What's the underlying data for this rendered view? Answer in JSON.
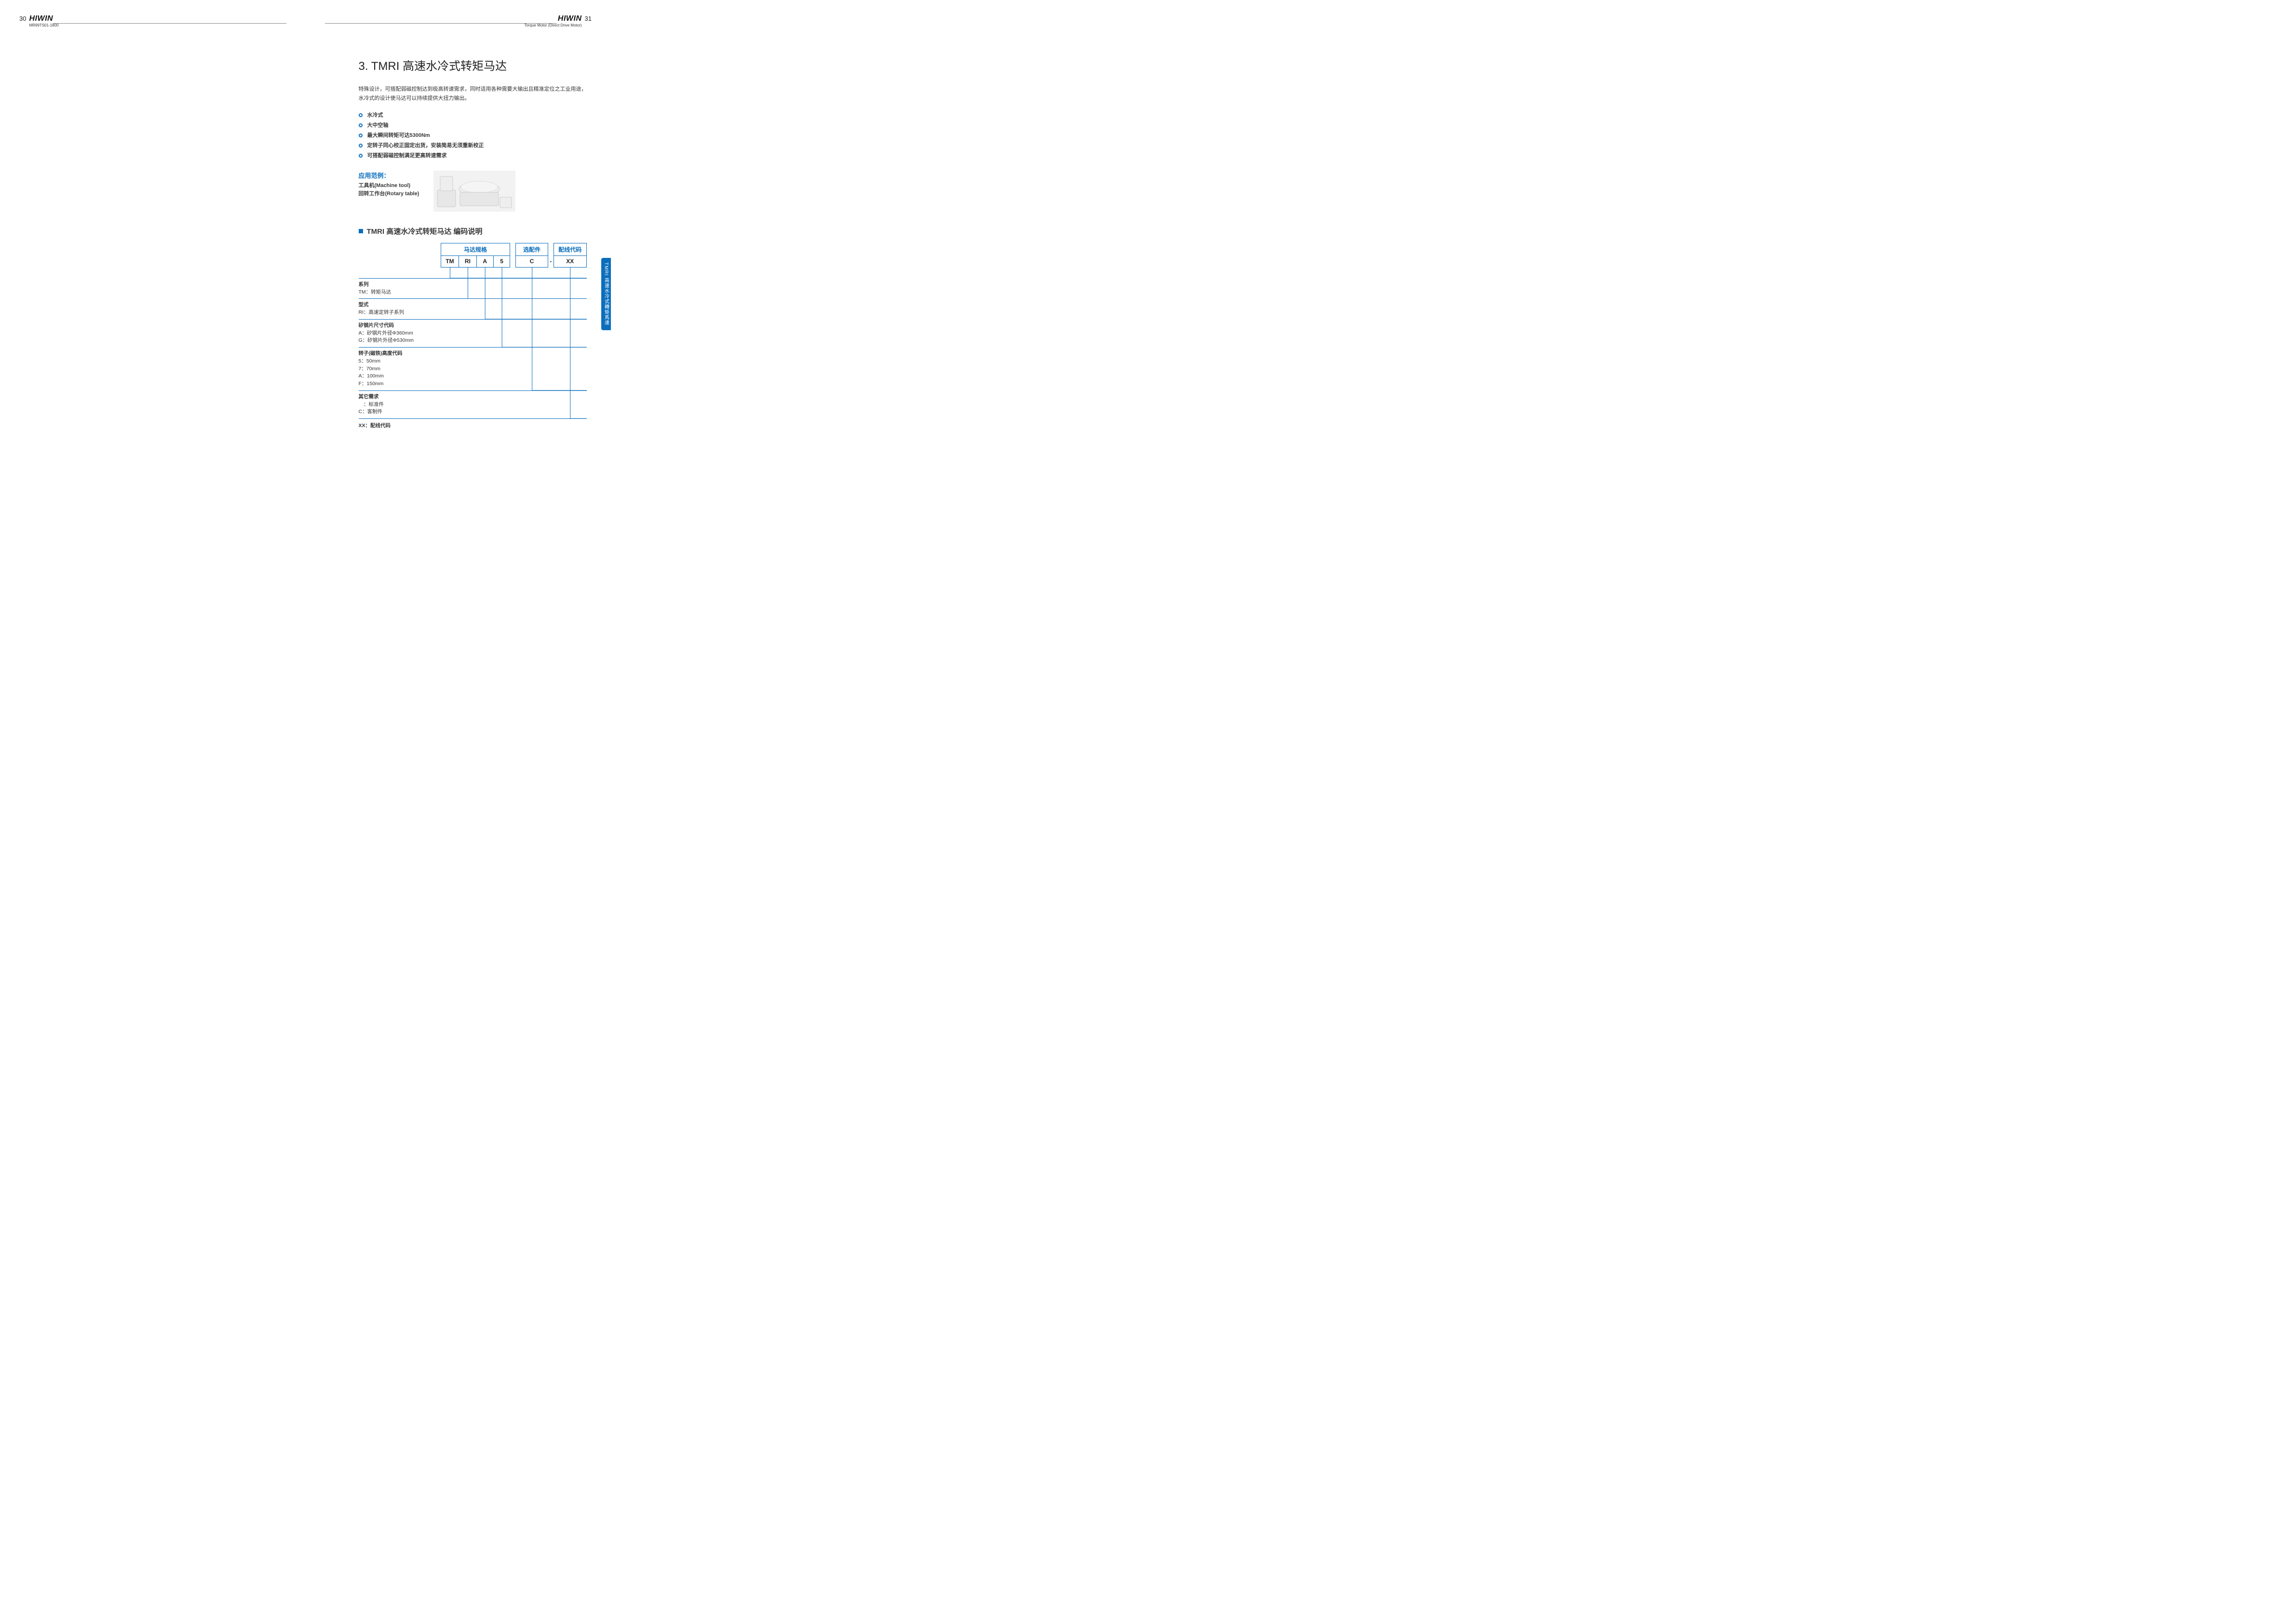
{
  "pageLeft": {
    "num": "30",
    "brand": "HIWIN",
    "sub": "MR99TS01-1800"
  },
  "pageRight": {
    "num": "31",
    "brand": "HIWIN",
    "sub": "Torque Motor (Direct Drive Motor)"
  },
  "title": "3. TMRI 高速水冷式转矩马达",
  "intro": "特殊设计，可搭配弱磁控制达到极高转速需求，同时适用各种需要大输出且精准定位之工业用途，水冷式的设计使马达可以持续提供大扭力输出。",
  "bullets": [
    "水冷式",
    "大中空轴",
    "最大瞬间转矩可达5300Nm",
    "定转子同心校正固定出货，安装简易无须重新校正",
    "可搭配弱磁控制满足更高转速需求"
  ],
  "applications": {
    "heading": "应用范例：",
    "items": [
      "工具机(Machine tool)",
      "回转工作台(Rotary table)"
    ]
  },
  "subheading": "TMRI 高速水冷式转矩马达 编码说明",
  "codeTable": {
    "headers": {
      "spec": "马达规格",
      "option": "选配件",
      "wire": "配线代码"
    },
    "row": {
      "tm": "TM",
      "ri": "RI",
      "a": "A",
      "five": "5",
      "c": "C",
      "dash": "-",
      "xx": "XX"
    }
  },
  "explains": [
    {
      "title": "系列",
      "lines": [
        "TM：转矩马达"
      ]
    },
    {
      "title": "型式",
      "lines": [
        "RI：高速定转子系列"
      ]
    },
    {
      "title": "矽钢片尺寸代码",
      "lines": [
        "A：矽钢片外径Φ360mm",
        "G：矽钢片外径Φ530mm"
      ]
    },
    {
      "title": "转子(磁铁)高度代码",
      "lines": [
        "5：50mm",
        "7：70mm",
        "A：100mm",
        "F：150mm"
      ]
    },
    {
      "title": "其它需求",
      "lines": [
        "　：标准件",
        "C：客制件"
      ]
    }
  ],
  "explainLast": "XX：配线代码",
  "sideTab": "TMRI 高速水冷式轉矩馬達"
}
